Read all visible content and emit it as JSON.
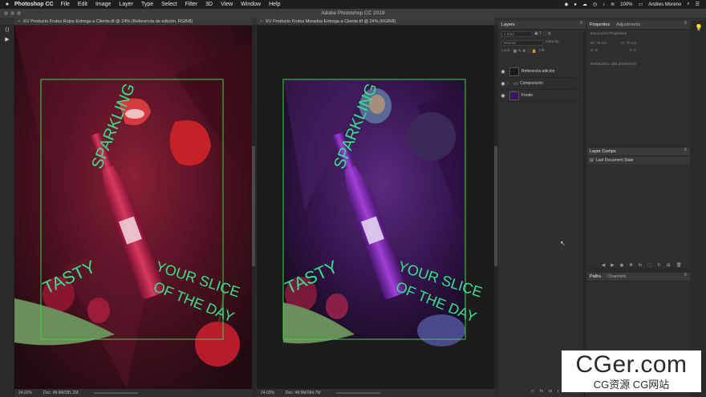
{
  "menubar": {
    "apple": "",
    "app_name": "Photoshop CC",
    "items": [
      "File",
      "Edit",
      "Image",
      "Layer",
      "Type",
      "Select",
      "Filter",
      "3D",
      "View",
      "Window",
      "Help"
    ],
    "battery": "100%",
    "user": "Andres Moreno"
  },
  "window_title": "Adobe Photoshop CC 2019",
  "documents": {
    "left_tab": "KV Producto Frutos Rojos Entrega a Cliente.tif @ 24% (Referencia de edición, RGB/8)",
    "right_tab": "KV Producto Frutos Morados Entrega a Cliente.tif @ 24% (RGB/8)",
    "left_zoom": "24.02%",
    "left_doc_info": "Doc: 48.9M/281.2M",
    "right_zoom": "24.02%",
    "right_doc_info": "Doc: 48.9M/284.7M",
    "artwork_text": {
      "sparkling": "SPARKLING",
      "tasty": "TASTY",
      "your_slice": "YOUR SLICE",
      "of_the_day": "OF THE DAY"
    }
  },
  "layers_panel": {
    "tab": "Layers",
    "filter": "Kind",
    "blend_mode": "Normal",
    "opacity_label": "Opacity:",
    "lock_label": "Lock:",
    "fill_label": "Fill:",
    "layers": [
      {
        "name": "Referencia edición"
      },
      {
        "name": "Composición"
      },
      {
        "name": "Fondo"
      }
    ]
  },
  "properties_panel": {
    "tabs": [
      "Properties",
      "Adjustments"
    ],
    "doc_props": "Document Properties",
    "w": "W: 70 cm",
    "h": "H: 70 cm",
    "x": "X: 0",
    "y": "Y: 0",
    "resolution": "Resolution: 150 pixels/inch"
  },
  "layer_comps_panel": {
    "tab": "Layer Comps",
    "item": "Last Document State"
  },
  "paths_panel": {
    "tabs": [
      "Paths",
      "Channels"
    ]
  },
  "watermark": {
    "line1": "CGer.com",
    "line2": "CG资源 CG网站"
  },
  "colors": {
    "selection_green": "#3fd24a",
    "artwork_text_green": "#38e08c",
    "left_bg": "#3a0c18",
    "right_bg": "#2a0f3e"
  }
}
